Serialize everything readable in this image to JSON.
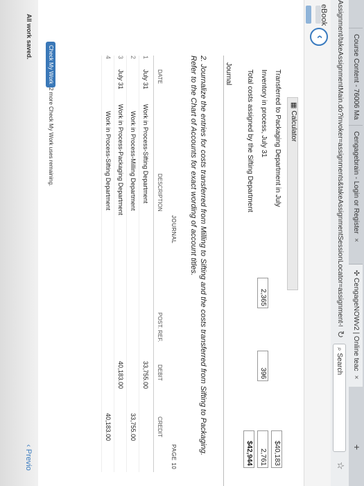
{
  "browser": {
    "tabs": [
      {
        "label": "Course Content - 76006 Ma"
      },
      {
        "label": "Cengagebrain - Login or Register"
      },
      {
        "label": "CengageNOWv2 | Online teac"
      }
    ],
    "new_tab": "+",
    "url": "Assignment/takeAssignmentMain.do?invoker=assignments&takeAssignmentSessionLocator=assignment-take&inpr",
    "search_placeholder": "Search"
  },
  "sidebar": {
    "ebook_label": "eBook"
  },
  "calculator": {
    "label": "Calculator",
    "rows": [
      {
        "label": "Transferred to Packaging Department in July",
        "mid": "",
        "right": "$40,183"
      },
      {
        "label": "Inventory in process, July 31",
        "left": "2,365",
        "mid": "396",
        "right": "2,761"
      },
      {
        "label": "Total costs assigned by the Sifting Department",
        "mid": "",
        "right": "$42,944"
      }
    ]
  },
  "journal_section": {
    "label": "Journal",
    "question": "2. Journalize the entries for costs transferred from Milling to Sifting and the costs transferred from Sifting to Packaging. Refer to the Chart of Accounts for exact wording of account titles.",
    "title": "JOURNAL",
    "page": "PAGE 10",
    "headers": {
      "date": "DATE",
      "description": "DESCRIPTION",
      "post_ref": "POST. REF.",
      "debit": "DEBIT",
      "credit": "CREDIT"
    },
    "rows": [
      {
        "num": "1",
        "date": "July 31",
        "description": "Work in Process-Sifting Department",
        "debit": "33,755.00",
        "credit": ""
      },
      {
        "num": "2",
        "date": "",
        "description": "Work in Process-Milling Department",
        "debit": "",
        "credit": "33,755.00"
      },
      {
        "num": "3",
        "date": "July 31",
        "description": "Work in Process-Packaging Department",
        "debit": "40,183.00",
        "credit": ""
      },
      {
        "num": "4",
        "date": "",
        "description": "Work in Process-Sifting Department",
        "debit": "",
        "credit": "40,183.00"
      }
    ]
  },
  "footer": {
    "check_button": "Check My Work",
    "remaining": "2 more Check My Work uses remaining.",
    "saved": "All work saved.",
    "previous": "Previo"
  }
}
